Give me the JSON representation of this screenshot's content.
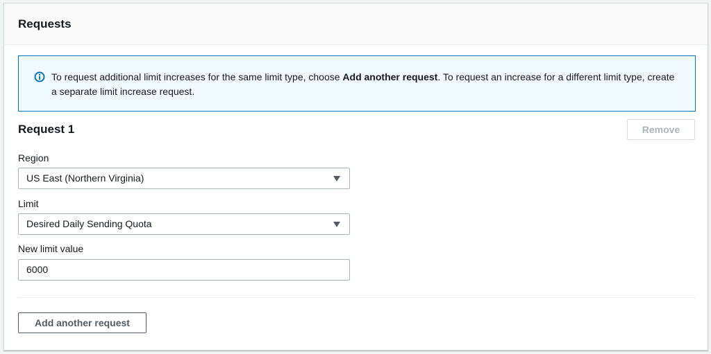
{
  "panel": {
    "title": "Requests"
  },
  "info": {
    "icon": "info-icon",
    "text_before": "To request additional limit increases for the same limit type, choose ",
    "text_bold": "Add another request",
    "text_after": ". To request an increase for a different limit type, create a separate limit increase request.",
    "accent_color": "#0073bb"
  },
  "request": {
    "title": "Request 1",
    "remove_label": "Remove",
    "region": {
      "label": "Region",
      "value": "US East (Northern Virginia)"
    },
    "limit": {
      "label": "Limit",
      "value": "Desired Daily Sending Quota"
    },
    "new_limit": {
      "label": "New limit value",
      "value": "6000"
    }
  },
  "actions": {
    "add_label": "Add another request"
  }
}
